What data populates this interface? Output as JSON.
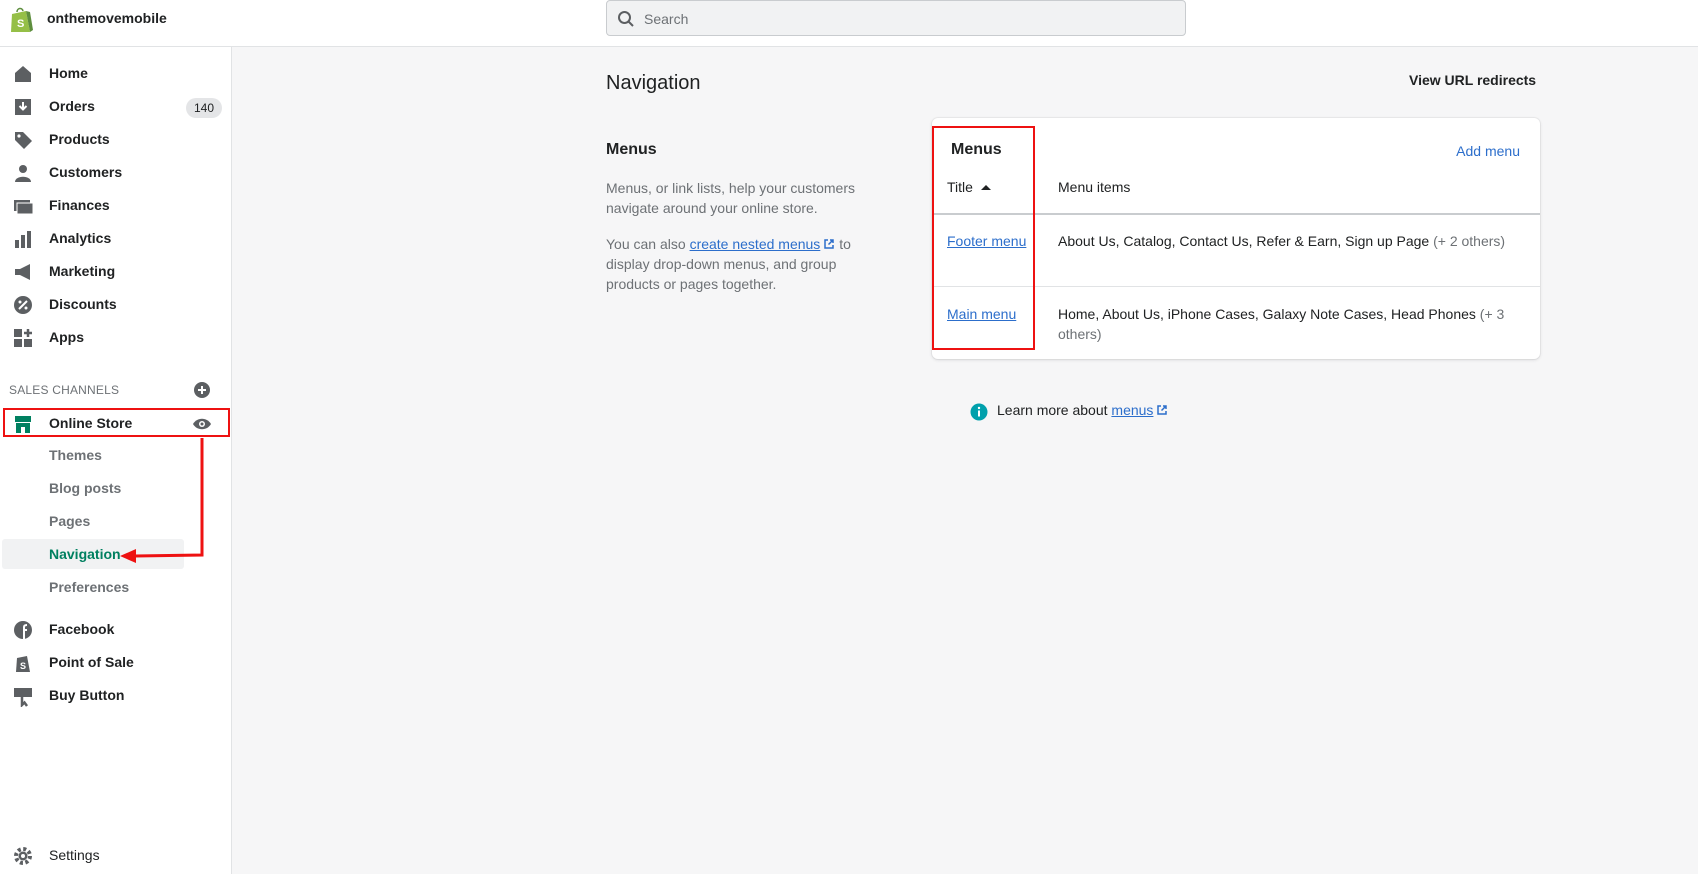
{
  "store": {
    "name": "onthemovemobile"
  },
  "search": {
    "placeholder": "Search"
  },
  "sidebar": {
    "items": [
      {
        "label": "Home",
        "icon": "home-icon"
      },
      {
        "label": "Orders",
        "icon": "orders-icon",
        "badge": "140"
      },
      {
        "label": "Products",
        "icon": "tag-icon"
      },
      {
        "label": "Customers",
        "icon": "person-icon"
      },
      {
        "label": "Finances",
        "icon": "finances-icon"
      },
      {
        "label": "Analytics",
        "icon": "analytics-icon"
      },
      {
        "label": "Marketing",
        "icon": "megaphone-icon"
      },
      {
        "label": "Discounts",
        "icon": "discount-icon"
      },
      {
        "label": "Apps",
        "icon": "apps-icon"
      }
    ],
    "sales_channels_header": "SALES CHANNELS",
    "online_store": "Online Store",
    "sub_items": [
      "Themes",
      "Blog posts",
      "Pages",
      "Navigation",
      "Preferences"
    ],
    "channels": [
      {
        "label": "Facebook",
        "icon": "facebook-icon"
      },
      {
        "label": "Point of Sale",
        "icon": "pos-icon"
      },
      {
        "label": "Buy Button",
        "icon": "buy-button-icon"
      }
    ],
    "settings": "Settings"
  },
  "main": {
    "title": "Navigation",
    "view_redirects": "View URL redirects",
    "section_title": "Menus",
    "desc1": "Menus, or link lists, help your customers navigate around your online store.",
    "desc2_pre": "You can also ",
    "desc2_link": "create nested menus",
    "desc2_post": " to display drop-down menus, and group products or pages together.",
    "card": {
      "title": "Menus",
      "add_menu": "Add menu",
      "col_title": "Title",
      "col_items": "Menu items",
      "rows": [
        {
          "title": "Footer menu",
          "items": "About Us, Catalog, Contact Us, Refer & Earn, Sign up Page",
          "more": "(+ 2 others)"
        },
        {
          "title": "Main menu",
          "items": "Home, About Us, iPhone Cases, Galaxy Note Cases, Head Phones",
          "more": "(+ 3 others)"
        }
      ]
    },
    "learn_pre": "Learn more about ",
    "learn_link": "menus"
  },
  "colors": {
    "accent_green": "#008060",
    "link_blue": "#2c6ecb",
    "annotation_red": "#e11111"
  }
}
